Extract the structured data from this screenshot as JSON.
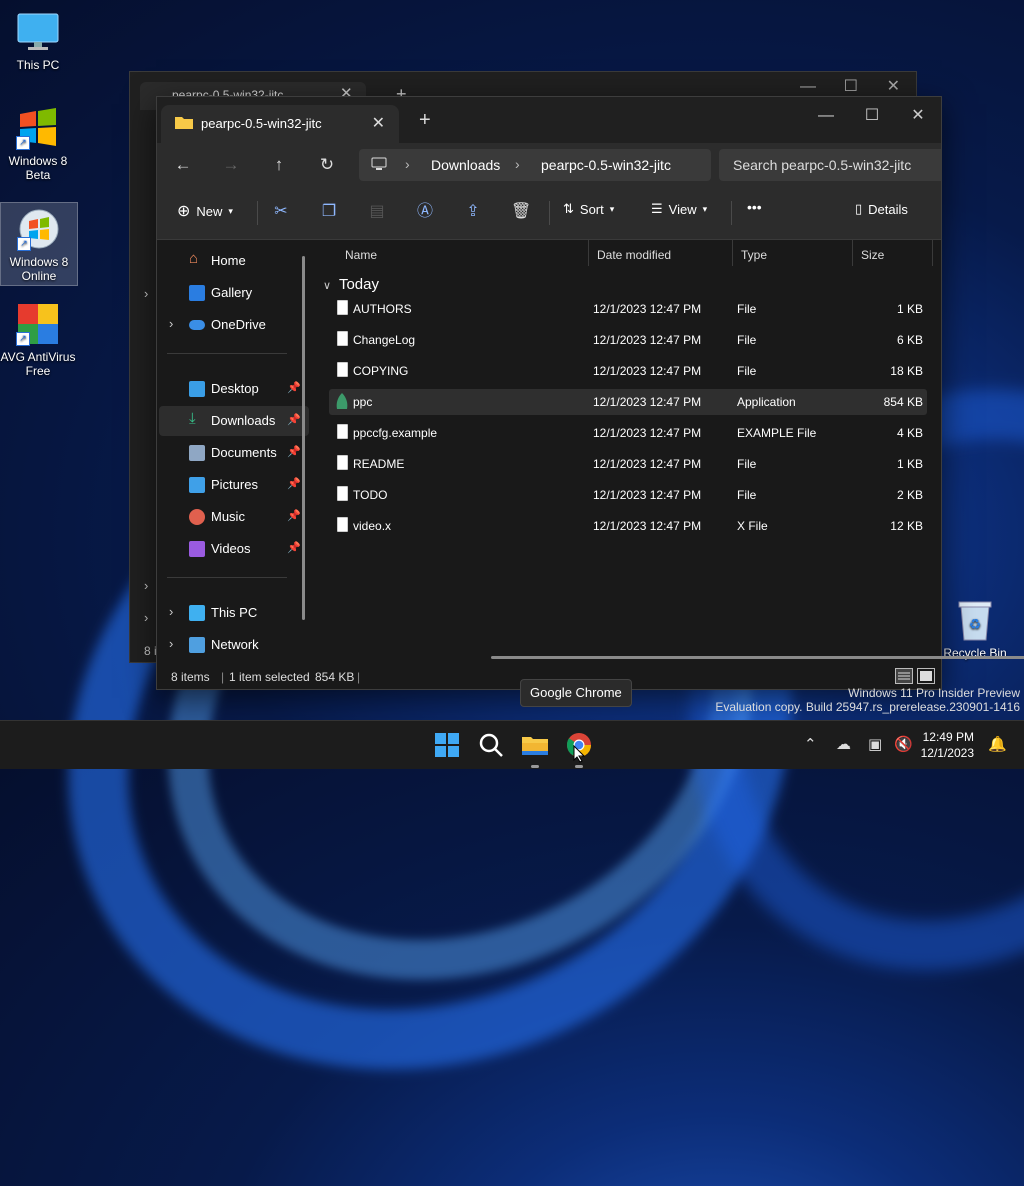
{
  "desktop": {
    "icons": [
      {
        "label": "This PC"
      },
      {
        "label": "Windows 8 Beta"
      },
      {
        "label": "Windows 8 Online"
      },
      {
        "label": "AVG AntiVirus Free"
      },
      {
        "label": "Recycle Bin"
      }
    ]
  },
  "back_window": {
    "tab_title": "pearpc-0.5-win32-jitc",
    "status_fragment": "8 i"
  },
  "window": {
    "tab_title": "pearpc-0.5-win32-jitc",
    "new_tab": "+",
    "controls": {
      "minimize": "—",
      "maximize": "☐",
      "close": "✕"
    },
    "breadcrumb": [
      "Downloads",
      "pearpc-0.5-win32-jitc"
    ],
    "search_placeholder": "Search pearpc-0.5-win32-jitc",
    "commands": {
      "new": "New",
      "sort": "Sort",
      "view": "View",
      "more": "•••",
      "details": "Details"
    },
    "nav": {
      "home": "Home",
      "gallery": "Gallery",
      "onedrive": "OneDrive",
      "desktop": "Desktop",
      "downloads": "Downloads",
      "documents": "Documents",
      "pictures": "Pictures",
      "music": "Music",
      "videos": "Videos",
      "thispc": "This PC",
      "network": "Network"
    },
    "columns": {
      "name": "Name",
      "date": "Date modified",
      "type": "Type",
      "size": "Size"
    },
    "group": "Today",
    "files": [
      {
        "name": "AUTHORS",
        "date": "12/1/2023 12:47 PM",
        "type": "File",
        "size": "1 KB"
      },
      {
        "name": "ChangeLog",
        "date": "12/1/2023 12:47 PM",
        "type": "File",
        "size": "6 KB"
      },
      {
        "name": "COPYING",
        "date": "12/1/2023 12:47 PM",
        "type": "File",
        "size": "18 KB"
      },
      {
        "name": "ppc",
        "date": "12/1/2023 12:47 PM",
        "type": "Application",
        "size": "854 KB"
      },
      {
        "name": "ppccfg.example",
        "date": "12/1/2023 12:47 PM",
        "type": "EXAMPLE File",
        "size": "4 KB"
      },
      {
        "name": "README",
        "date": "12/1/2023 12:47 PM",
        "type": "File",
        "size": "1 KB"
      },
      {
        "name": "TODO",
        "date": "12/1/2023 12:47 PM",
        "type": "File",
        "size": "2 KB"
      },
      {
        "name": "video.x",
        "date": "12/1/2023 12:47 PM",
        "type": "X File",
        "size": "12 KB"
      }
    ],
    "status": {
      "items": "8 items",
      "selected": "1 item selected",
      "size": "854 KB"
    }
  },
  "tooltip": "Google Chrome",
  "watermark": {
    "line1": "Windows 11 Pro Insider Preview",
    "line2": "Evaluation copy. Build 25947.rs_prerelease.230901-1416"
  },
  "taskbar": {
    "time": "12:49 PM",
    "date": "12/1/2023"
  }
}
